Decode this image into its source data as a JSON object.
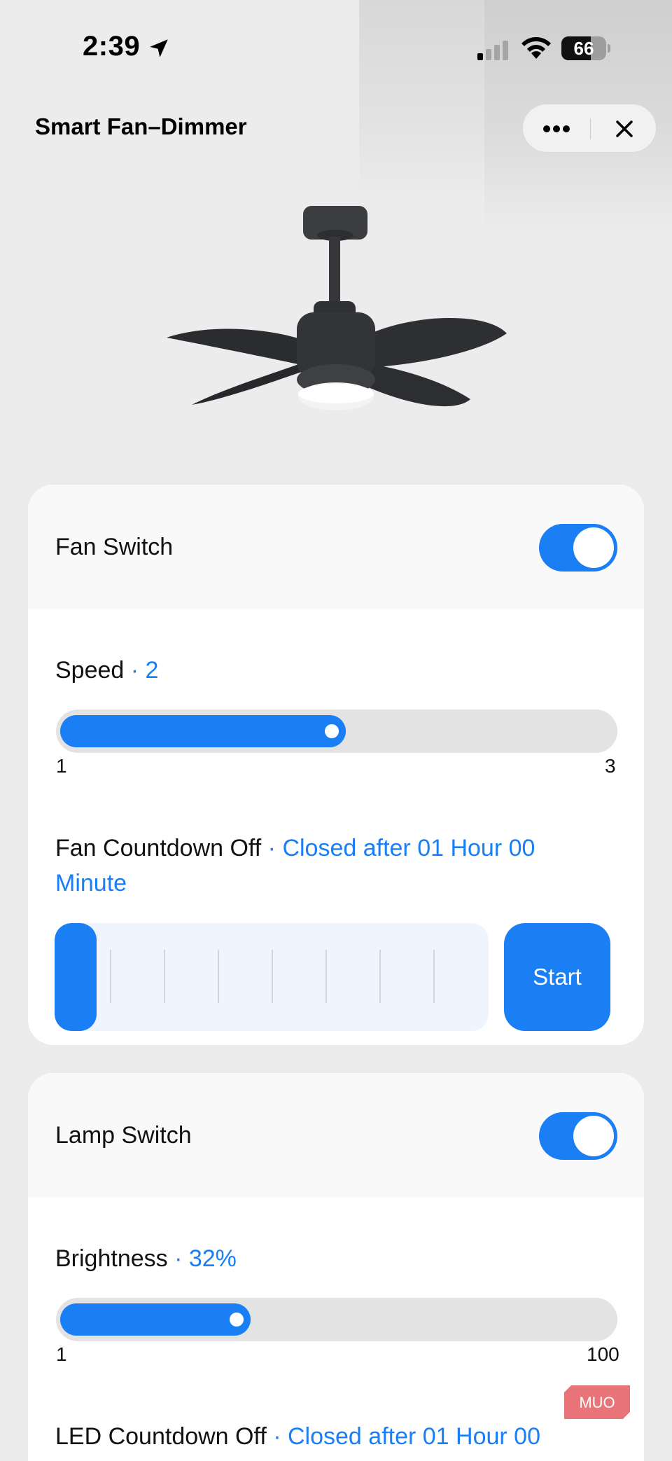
{
  "status_bar": {
    "time": "2:39",
    "battery": "66",
    "battery_level": 0.66
  },
  "header": {
    "title": "Smart Fan–Dimmer"
  },
  "fan_card": {
    "switch_label": "Fan Switch",
    "switch_on": true,
    "speed": {
      "label": "Speed",
      "value": "· 2",
      "min": "1",
      "max": "3",
      "level": 2
    },
    "countdown": {
      "label": "Fan Countdown Off",
      "value_line1": "· Closed after 01 Hour 00",
      "value_line2": "Minute",
      "start_label": "Start"
    }
  },
  "lamp_card": {
    "switch_label": "Lamp Switch",
    "switch_on": true,
    "brightness": {
      "label": "Brightness",
      "value": "· 32%",
      "min": "1",
      "max": "100",
      "level": 32
    },
    "countdown": {
      "label": "LED Countdown Off",
      "value": "· Closed after 01 Hour 00"
    }
  },
  "watermark": {
    "text": "MUO"
  },
  "colors": {
    "accent": "#1a7ef5",
    "background": "#ececec",
    "card": "#ffffff"
  }
}
